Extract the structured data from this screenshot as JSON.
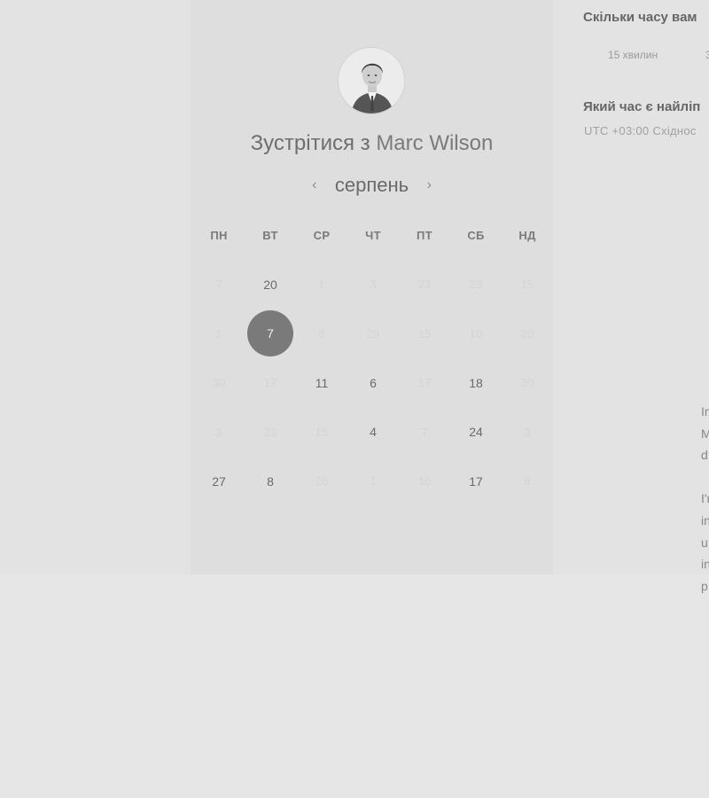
{
  "booking": {
    "title_prefix": "Зустрітися з",
    "host_name": "Marc Wilson",
    "month": "серпень",
    "prev_icon": "chevron-left-icon",
    "next_icon": "chevron-right-icon"
  },
  "weekdays": [
    "ПН",
    "ВТ",
    "СР",
    "ЧТ",
    "ПТ",
    "СБ",
    "НД"
  ],
  "weeks": [
    [
      {
        "d": "7",
        "s": "dim"
      },
      {
        "d": "20",
        "s": "avail"
      },
      {
        "d": "1",
        "s": "dim"
      },
      {
        "d": "3",
        "s": "dim"
      },
      {
        "d": "23",
        "s": "dim"
      },
      {
        "d": "23",
        "s": "dim"
      },
      {
        "d": "15",
        "s": "dim"
      }
    ],
    [
      {
        "d": "1",
        "s": "dim"
      },
      {
        "d": "7",
        "s": "selected"
      },
      {
        "d": "8",
        "s": "dim"
      },
      {
        "d": "29",
        "s": "dim"
      },
      {
        "d": "15",
        "s": "dim"
      },
      {
        "d": "10",
        "s": "dim"
      },
      {
        "d": "20",
        "s": "dim"
      }
    ],
    [
      {
        "d": "30",
        "s": "dim"
      },
      {
        "d": "17",
        "s": "dim"
      },
      {
        "d": "11",
        "s": "avail"
      },
      {
        "d": "6",
        "s": "avail"
      },
      {
        "d": "17",
        "s": "dim"
      },
      {
        "d": "18",
        "s": "avail"
      },
      {
        "d": "20",
        "s": "dim"
      }
    ],
    [
      {
        "d": "3",
        "s": "dim"
      },
      {
        "d": "23",
        "s": "dim"
      },
      {
        "d": "15",
        "s": "dim"
      },
      {
        "d": "4",
        "s": "avail"
      },
      {
        "d": "7",
        "s": "dim"
      },
      {
        "d": "24",
        "s": "avail"
      },
      {
        "d": "3",
        "s": "dim"
      }
    ],
    [
      {
        "d": "27",
        "s": "avail"
      },
      {
        "d": "8",
        "s": "avail"
      },
      {
        "d": "26",
        "s": "dim"
      },
      {
        "d": "1",
        "s": "dim"
      },
      {
        "d": "16",
        "s": "dim"
      },
      {
        "d": "17",
        "s": "avail"
      },
      {
        "d": "6",
        "s": "dim"
      }
    ]
  ],
  "details": {
    "duration_question": "Скільки часу вам",
    "durations": [
      "15 хвилин",
      "3"
    ],
    "time_question": "Який час є найліп",
    "timezone": "UTC +03:00 Східнос",
    "description_fragments": [
      "In",
      "M",
      "d",
      "I'r",
      "in",
      "u",
      "in",
      "p"
    ]
  }
}
